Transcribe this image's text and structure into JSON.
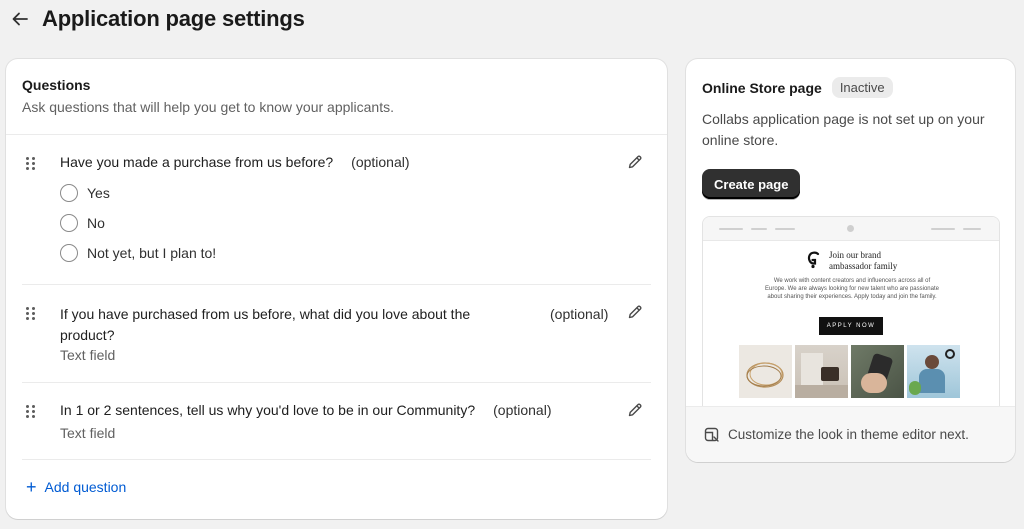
{
  "header": {
    "title": "Application page settings",
    "back_icon": "arrow-left-icon"
  },
  "questions": {
    "title": "Questions",
    "subtitle": "Ask questions that will help you get to know your applicants.",
    "items": [
      {
        "text": "Have you made a purchase from us before?",
        "optional": "(optional)",
        "options": [
          "Yes",
          "No",
          "Not yet, but I plan to!"
        ]
      },
      {
        "text_line1": "If you have purchased from us before, what did you love about the",
        "text_line2": "product?",
        "optional": "(optional)",
        "type": "Text field"
      },
      {
        "text": "In 1 or 2 sentences, tell us why you'd love to be in our Community?",
        "optional": "(optional)",
        "type": "Text field"
      }
    ],
    "add_label": "Add question"
  },
  "store": {
    "title": "Online Store page",
    "badge": "Inactive",
    "description": "Collabs application page is not set up on your online store.",
    "button": "Create page",
    "preview": {
      "brand_line1": "Join our brand",
      "brand_line2": "ambassador family",
      "body": "We work with content creators and influencers across all of Europe. We are always looking for new talent who are passionate about sharing their experiences. Apply today and join the family.",
      "cta": "APPLY NOW"
    },
    "footer": "Customize the look in theme editor next."
  }
}
